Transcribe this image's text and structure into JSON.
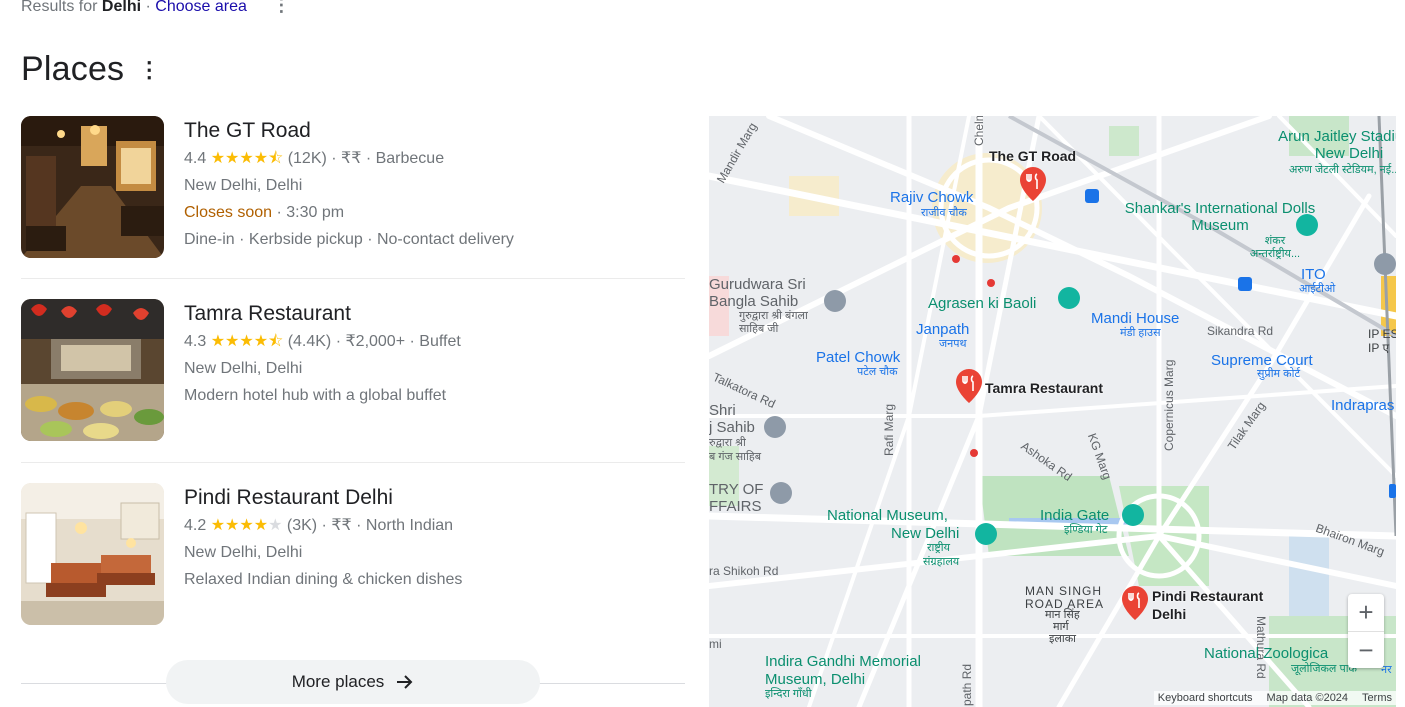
{
  "header": {
    "results_prefix": "Results for",
    "location": "Delhi",
    "separator": "·",
    "choose_area": "Choose area",
    "title": "Places"
  },
  "places": [
    {
      "name": "The GT Road",
      "rating": "4.4",
      "rating_value": 4.4,
      "reviews": "(12K)",
      "price": "₹₹",
      "category": "Barbecue",
      "address": "New Delhi, Delhi",
      "status": "Closes soon",
      "hours": "· 3:30 pm",
      "services": "Dine-in · Kerbside pickup · No-contact delivery"
    },
    {
      "name": "Tamra Restaurant",
      "rating": "4.3",
      "rating_value": 4.3,
      "reviews": "(4.4K)",
      "price": "₹2,000+",
      "category": "Buffet",
      "address": "New Delhi, Delhi",
      "description": "Modern hotel hub with a global buffet"
    },
    {
      "name": "Pindi Restaurant Delhi",
      "rating": "4.2",
      "rating_value": 4.2,
      "reviews": "(3K)",
      "price": "₹₹",
      "category": "North Indian",
      "address": "New Delhi, Delhi",
      "description": "Relaxed Indian dining & chicken dishes"
    }
  ],
  "more_places": "More places",
  "map": {
    "pins": {
      "gt_road": "The GT Road",
      "tamra": "Tamra Restaurant",
      "pindi": "Pindi Restaurant Delhi"
    },
    "labels": {
      "arun_jaitley": "Arun Jaitley Stadium, New Delhi",
      "arun_hi": "अरुण जेटली स्टेडियम, नई...",
      "rajiv_chowk": "Rajiv Chowk",
      "rajiv_hi": "राजीव चौक",
      "shankars": "Shankar's International Dolls Museum",
      "shankar_hi": "शंकर अन्तर्राष्ट्रीय...",
      "gurudwara": "Gurudwara Sri Bangla Sahib",
      "gurudwara_hi": "गुरुद्वारा श्री बंगला साहिब जी",
      "agrasen": "Agrasen ki Baoli",
      "ito": "ITO",
      "ito_hi": "आईटीओ",
      "janpath": "Janpath",
      "janpath_hi": "जनपथ",
      "mandi_house": "Mandi House",
      "mandi_hi": "मंडी हाउस",
      "sikandra": "Sikandra Rd",
      "ip_est": "IP EST",
      "ip_hi": "IP ए",
      "patel_chowk": "Patel Chowk",
      "patel_hi": "पटेल चौक",
      "supreme_court": "Supreme Court",
      "supreme_hi": "सुप्रीम कोर्ट",
      "talkatora": "Talkatora Rd",
      "rakab": "Rakab Ganj Sahib",
      "rakab_1": "Shri",
      "rakab_2": "j Sahib",
      "rakab_hi1": "रुद्वारा श्री",
      "rakab_hi2": "ब गंज साहिब",
      "indrapras": "Indrapras",
      "rafi": "Rafi Marg",
      "ashoka": "Ashoka Rd",
      "kg_marg": "KG Marg",
      "copernicus": "Copernicus Marg",
      "tilak": "Tilak Marg",
      "ministry": "TRY OF",
      "ministry2": "FFAIRS",
      "national_museum": "National Museum,",
      "national_museum2": "New Delhi",
      "nm_hi1": "राष्ट्रीय",
      "nm_hi2": "संग्रहालय",
      "india_gate": "India Gate",
      "india_gate_hi": "इण्डिया गेट",
      "shikoh": "ra Shikoh Rd",
      "man_singh": "MAN SINGH",
      "man_singh2": "ROAD AREA",
      "man_singh_hi1": "मान सिंह",
      "man_singh_hi2": "मार्ग",
      "man_singh_hi3": "इलाका",
      "bhairon": "Bhairon Marg",
      "mathura": "Mathura Rd",
      "igm": "Indira Gandhi Memorial",
      "igm2": "Museum, Delhi",
      "igm_hi": "इन्दिरा गाँधी",
      "nzp": "National Zoologica",
      "nzp_hi": "जूलोजिकल पार्क",
      "mandir": "Mandir Marg",
      "chelm": "Chelm",
      "path_rd": "path Rd",
      "mi": "mi",
      "hi_blue": "नर"
    },
    "attribution": {
      "shortcuts": "Keyboard shortcuts",
      "data": "Map data ©2024",
      "terms": "Terms"
    },
    "zoom_in": "+",
    "zoom_out": "−"
  }
}
